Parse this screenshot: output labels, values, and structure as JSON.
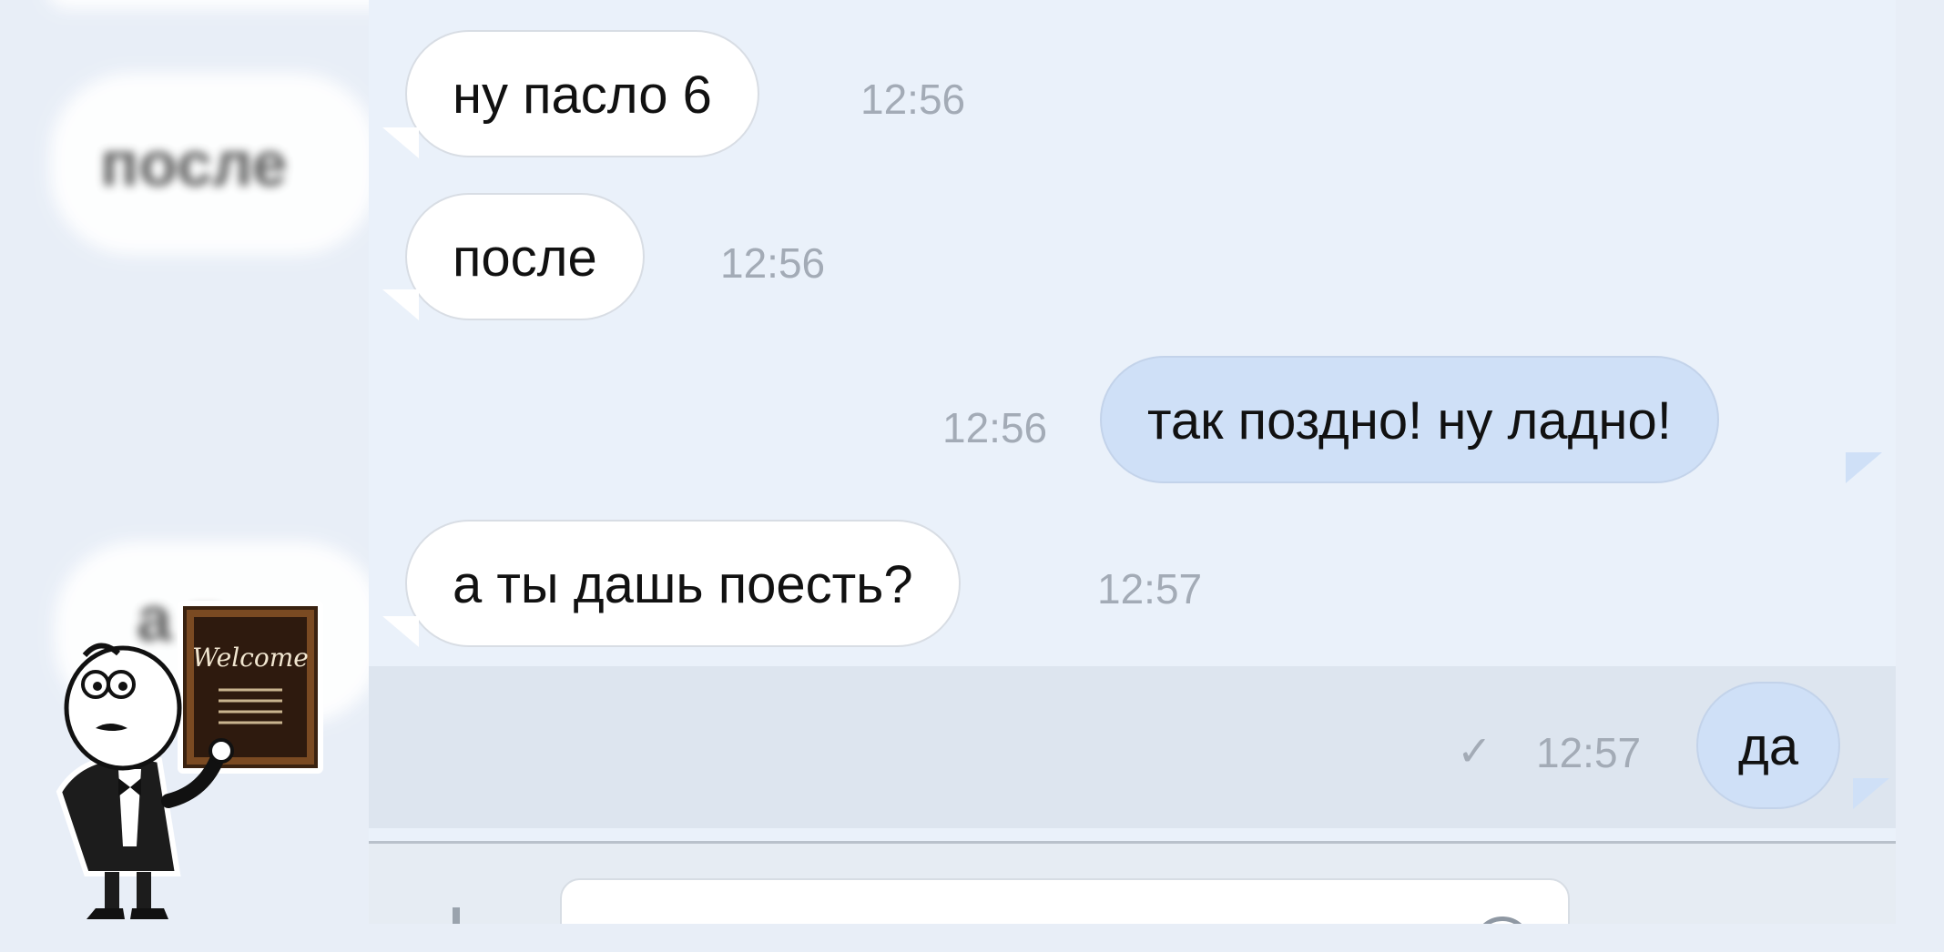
{
  "blurred_background": {
    "text_1": "после",
    "text_2": "а т"
  },
  "messages": [
    {
      "direction": "in",
      "text": "ну пасло 6",
      "time": "12:56"
    },
    {
      "direction": "in",
      "text": "после",
      "time": "12:56"
    },
    {
      "direction": "out",
      "text": "так поздно! ну ладно!",
      "time": "12:56"
    },
    {
      "direction": "in",
      "text": "а ты дашь поесть?",
      "time": "12:57"
    },
    {
      "direction": "out",
      "text": "да",
      "time": "12:57",
      "status_icon": "check-icon",
      "unread": true
    }
  ],
  "mascot": {
    "sign_text": "Welcome"
  },
  "colors": {
    "incoming_bubble": "#ffffff",
    "outgoing_bubble": "#cfe0f7",
    "background": "#e8eef7",
    "timestamp": "#a3abb6"
  }
}
